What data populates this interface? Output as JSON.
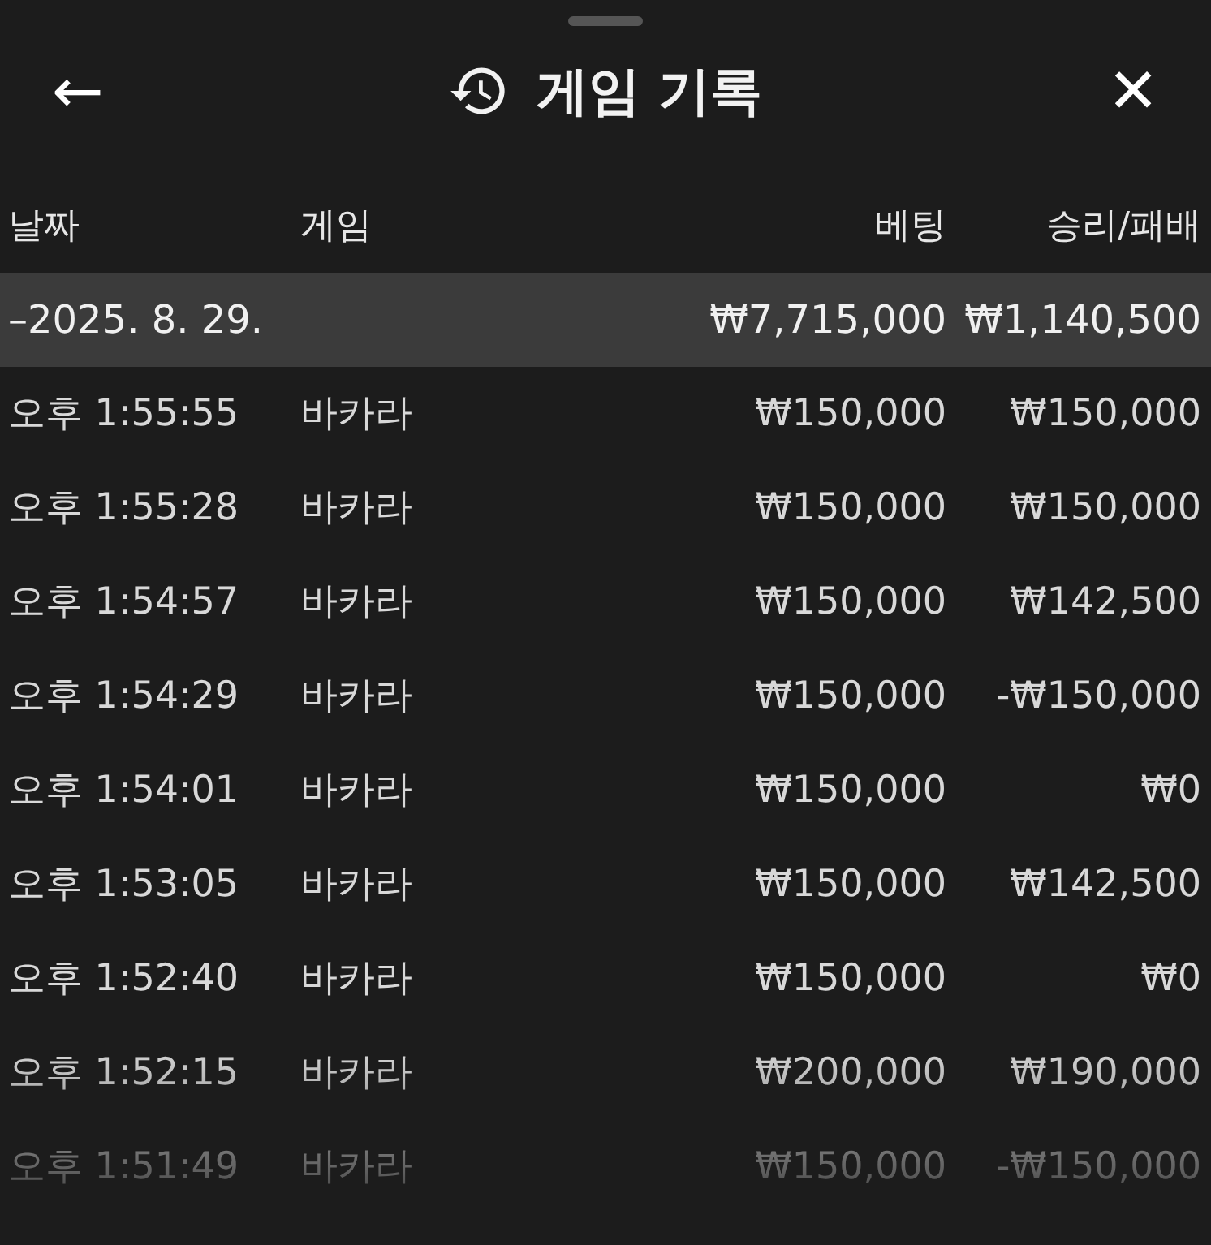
{
  "header": {
    "back": "←",
    "title": "게임 기록",
    "close": "✕"
  },
  "table": {
    "columns": [
      "날짜",
      "게임",
      "베팅",
      "승리/패배"
    ],
    "group": {
      "date": "–2025. 8. 29.",
      "bet": "₩7,715,000",
      "result": "₩1,140,500"
    },
    "rows": [
      {
        "time": "오후 1:55:55",
        "game": "바카라",
        "bet": "₩150,000",
        "result": "₩150,000"
      },
      {
        "time": "오후 1:55:28",
        "game": "바카라",
        "bet": "₩150,000",
        "result": "₩150,000"
      },
      {
        "time": "오후 1:54:57",
        "game": "바카라",
        "bet": "₩150,000",
        "result": "₩142,500"
      },
      {
        "time": "오후 1:54:29",
        "game": "바카라",
        "bet": "₩150,000",
        "result": "-₩150,000"
      },
      {
        "time": "오후 1:54:01",
        "game": "바카라",
        "bet": "₩150,000",
        "result": "₩0"
      },
      {
        "time": "오후 1:53:05",
        "game": "바카라",
        "bet": "₩150,000",
        "result": "₩142,500"
      },
      {
        "time": "오후 1:52:40",
        "game": "바카라",
        "bet": "₩150,000",
        "result": "₩0"
      },
      {
        "time": "오후 1:52:15",
        "game": "바카라",
        "bet": "₩200,000",
        "result": "₩190,000"
      },
      {
        "time": "오후 1:51:49",
        "game": "바카라",
        "bet": "₩150,000",
        "result": "-₩150,000"
      }
    ]
  }
}
